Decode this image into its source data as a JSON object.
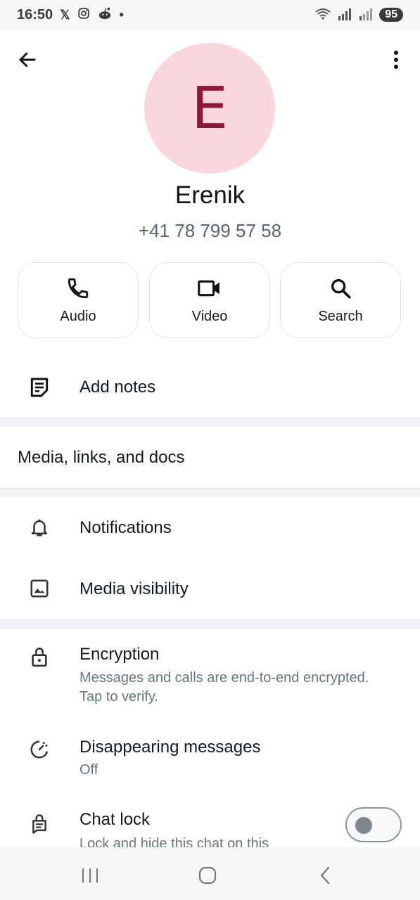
{
  "status_bar": {
    "time": "16:50",
    "battery": "95",
    "notification_icons": [
      "x-icon",
      "instagram-icon",
      "reddit-icon",
      "dot-icon"
    ]
  },
  "contact": {
    "avatar_letter": "E",
    "avatar_bg": "#f9d7dc",
    "avatar_fg": "#8e1a3b",
    "name": "Erenik",
    "phone": "+41 78 799 57 58"
  },
  "actions": [
    {
      "label": "Audio",
      "icon": "phone-icon"
    },
    {
      "label": "Video",
      "icon": "video-icon"
    },
    {
      "label": "Search",
      "icon": "search-icon"
    }
  ],
  "notes": {
    "label": "Add notes"
  },
  "media": {
    "label": "Media, links, and docs"
  },
  "settings": {
    "notifications": "Notifications",
    "media_visibility": "Media visibility"
  },
  "privacy": {
    "encryption_title": "Encryption",
    "encryption_sub": "Messages and calls are end-to-end encrypted. Tap to verify.",
    "disappearing_title": "Disappearing messages",
    "disappearing_sub": "Off",
    "chatlock_title": "Chat lock",
    "chatlock_sub": "Lock and hide this chat on this",
    "chatlock_enabled": false
  }
}
